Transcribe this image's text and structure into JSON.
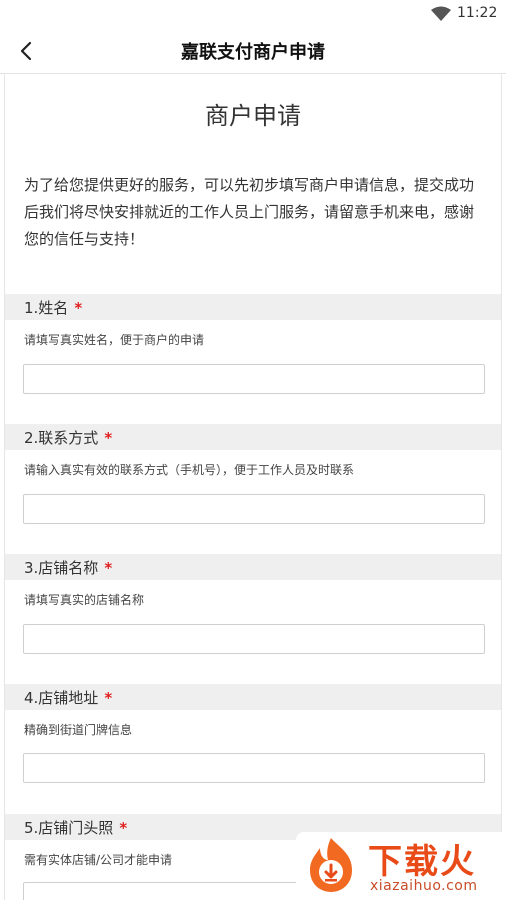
{
  "status_bar": {
    "time": "11:22",
    "wifi_icon": "wifi-icon"
  },
  "app_bar": {
    "title": "嘉联支付商户申请",
    "back_icon": "back-arrow-icon"
  },
  "page": {
    "heading": "商户申请",
    "intro": "为了给您提供更好的服务，可以先初步填写商户申请信息，提交成功后我们将尽快安排就近的工作人员上门服务，请留意手机来电，感谢您的信任与支持！"
  },
  "questions": [
    {
      "title": "1.姓名",
      "required": "*",
      "hint": "请填写真实姓名，便于商户的申请",
      "value": ""
    },
    {
      "title": "2.联系方式",
      "required": "*",
      "hint": "请输入真实有效的联系方式（手机号），便于工作人员及时联系",
      "value": ""
    },
    {
      "title": "3.店铺名称",
      "required": "*",
      "hint": "请填写真实的店铺名称",
      "value": ""
    },
    {
      "title": "4.店铺地址",
      "required": "*",
      "hint": "精确到街道门牌信息",
      "value": ""
    },
    {
      "title": "5.店铺门头照",
      "required": "*",
      "hint": "需有实体店铺/公司才能申请",
      "value": ""
    }
  ],
  "watermark": {
    "text": "下载火",
    "url_text": "xiazaihuo.com",
    "logo_icon": "flame-logo-icon"
  },
  "colors": {
    "required": "#e02020",
    "band": "#efefef",
    "watermark": "#e94b18"
  }
}
